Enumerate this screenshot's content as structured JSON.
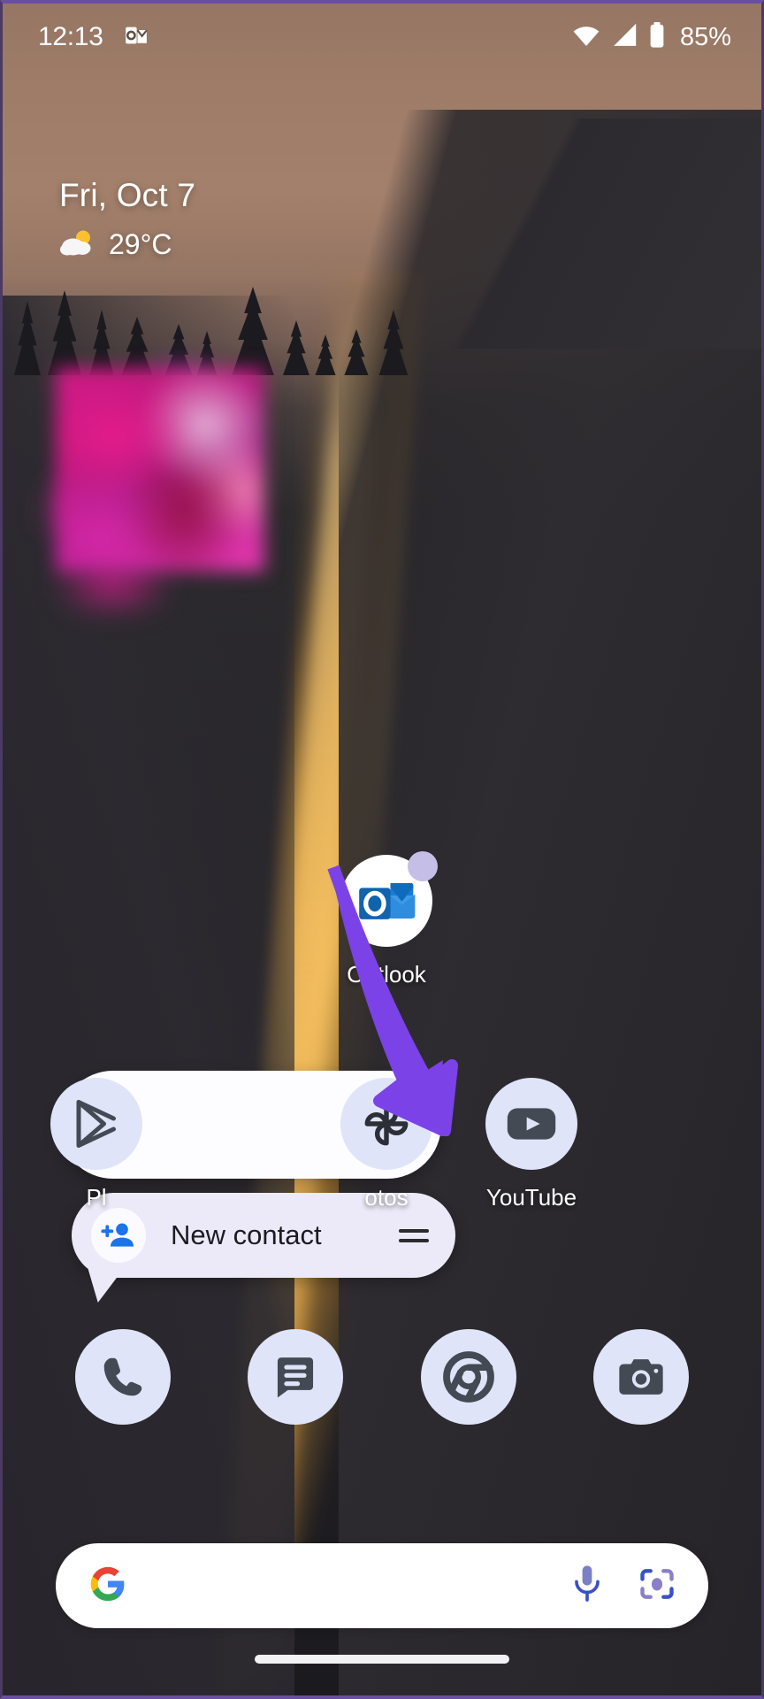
{
  "status_bar": {
    "time": "12:13",
    "notification_icon": "outlook-notification-icon",
    "wifi_icon": "wifi-icon",
    "signal_icon": "cellular-signal-icon",
    "battery_icon": "battery-icon",
    "battery_percent": "85%"
  },
  "widgets": {
    "date": "Fri, Oct 7",
    "weather_icon": "partly-cloudy-icon",
    "temperature": "29°C",
    "photo_widget_name": "photos-widget"
  },
  "apps": {
    "outlook": {
      "label": "Outlook",
      "icon": "outlook-icon",
      "badge": true
    },
    "play_store": {
      "label": "Pl",
      "icon": "play-store-icon"
    },
    "photos": {
      "label": "otos",
      "icon": "google-photos-icon"
    },
    "youtube": {
      "label": "YouTube",
      "icon": "youtube-icon"
    }
  },
  "dock": {
    "items": [
      {
        "label": "Phone",
        "icon": "phone-icon"
      },
      {
        "label": "Messages",
        "icon": "messages-icon"
      },
      {
        "label": "Chrome",
        "icon": "chrome-icon"
      },
      {
        "label": "Camera",
        "icon": "camera-icon"
      }
    ]
  },
  "search": {
    "logo": "google-g-icon",
    "placeholder": "",
    "value": "",
    "mic_icon": "microphone-icon",
    "lens_icon": "google-lens-icon"
  },
  "popup": {
    "info_icon": "app-info-icon",
    "shortcut": {
      "label": "New contact",
      "icon": "add-person-icon",
      "handle_icon": "drag-handle-icon"
    }
  },
  "annotation": {
    "arrow_icon": "arrow-pointer-icon",
    "arrow_color": "#7b42e8"
  },
  "nav": {
    "pill": "home-gesture-pill"
  },
  "colors": {
    "icon_circle": "#dfe4f8",
    "icon_glyph": "#434a54",
    "popup_bg": "#eceaf8",
    "accent_purple": "#7b42e8",
    "outlook_blue": "#0f6cbd"
  }
}
